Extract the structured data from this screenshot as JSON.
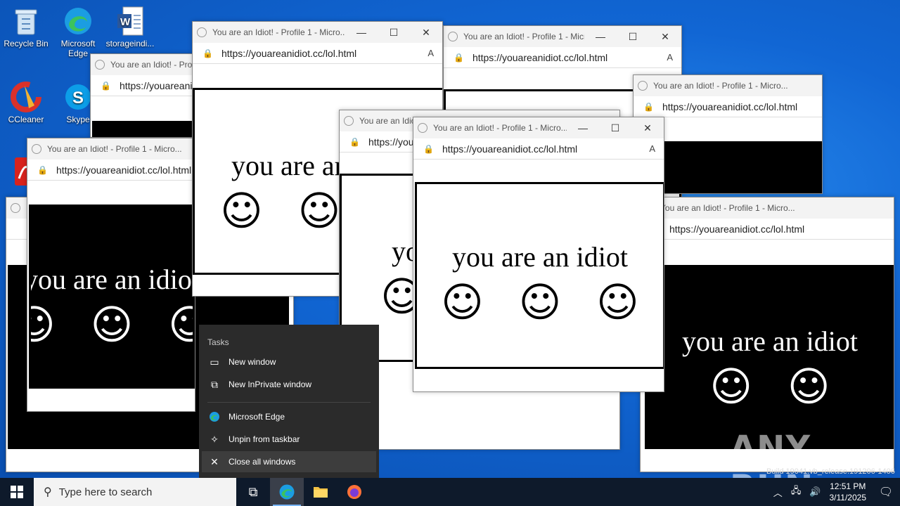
{
  "desktop": {
    "icons": [
      {
        "label": "Recycle Bin"
      },
      {
        "label": "Microsoft Edge"
      },
      {
        "label": "storageindi..."
      },
      {
        "label": "CCleaner"
      },
      {
        "label": "Skype"
      }
    ]
  },
  "browser": {
    "url": "https://youareanidiot.cc/lol.html",
    "message": "you are an idiot",
    "face": "☺"
  },
  "windows": [
    {
      "title": "You are an Idiot! - Profile 1 - Micro...",
      "url": "https://youareanidiot.cc/lol.html",
      "message": "you are an idiot"
    },
    {
      "title": "You are an Idiot! - Profile 1 - Micro...",
      "url": "https://youareanidiot.cc/lol.html",
      "message": "you are an idiot"
    },
    {
      "title": "You are an Idiot! - Profile 1 - Micro...",
      "url": "https://youareanidiot.cc/lol.html",
      "message": "you are an idiot"
    },
    {
      "title": "You are an Idiot! - Profile 1 - Micro...",
      "url": "https://youareanidiot.cc/lol.html",
      "message": "you are an idiot"
    },
    {
      "title": "You are an Idiot! - Profile 1 - Micro...",
      "url": "https://youareanidiot.cc/lol.html",
      "message": "you are an idiot"
    },
    {
      "title": "You are an Idiot! - Profile 1 - Micro...",
      "url": "https://youareanidiot.cc/lol.html",
      "message": "you are an idiot"
    }
  ],
  "jumplist": {
    "header": "Tasks",
    "items": [
      {
        "label": "New window",
        "icon": "window-icon"
      },
      {
        "label": "New InPrivate window",
        "icon": "inprivate-icon"
      },
      {
        "label": "Microsoft Edge",
        "icon": "edge-icon"
      },
      {
        "label": "Unpin from taskbar",
        "icon": "unpin-icon"
      },
      {
        "label": "Close all windows",
        "icon": "close-icon"
      }
    ]
  },
  "taskbar": {
    "search_placeholder": "Type here to search",
    "time": "12:51 PM",
    "date": "3/11/2025"
  },
  "watermark": "ANY RUN",
  "build_text": "Build 19041.vb_release.191206-1406"
}
